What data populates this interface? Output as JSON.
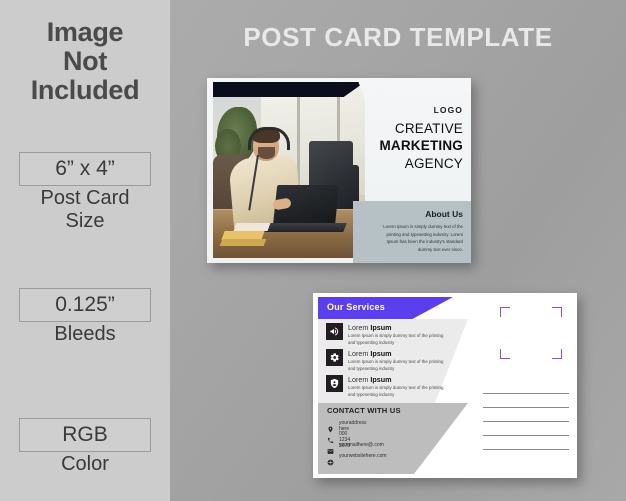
{
  "left_panel": {
    "headline_lines": [
      "Image",
      "Not",
      "Included"
    ],
    "specs": [
      {
        "value": "6” x 4”",
        "caption": "Post Card\nSize"
      },
      {
        "value": "0.125”",
        "caption": "Bleeds"
      },
      {
        "value": "RGB",
        "caption": "Color"
      }
    ]
  },
  "main_title": "POST CARD TEMPLATE",
  "front_card": {
    "logo": "LOGO",
    "company_line1": "CREATIVE",
    "company_line2": "MARKETING",
    "company_line3": "AGENCY",
    "about_title": "About Us",
    "about_body": "Lorem Ipsum is simply dummy text of the printing and typesetting industry. Lorem Ipsum has been the industry's standard dummy text ever since.",
    "accent_dark": "#0a0e1c",
    "about_panel_color": "#b6c1c5"
  },
  "back_card": {
    "services_title": "Our Services",
    "services": [
      {
        "icon": "megaphone-icon",
        "title_light": "Lorem ",
        "title_bold": "Ipsum",
        "body": "Lorem Ipsum is simply dummy text of the printing and typesetting industry"
      },
      {
        "icon": "gear-icon",
        "title_light": "Lorem ",
        "title_bold": "Ipsum",
        "body": "Lorem Ipsum is simply dummy text of the printing and typesetting industry"
      },
      {
        "icon": "shield-icon",
        "title_light": "Lorem ",
        "title_bold": "Ipsum",
        "body": "Lorem Ipsum is simply dummy text of the printing and typesetting industry"
      }
    ],
    "contact_title": "CONTACT WITH US",
    "contacts": [
      {
        "icon": "location-pin-icon",
        "text": "youraddress here"
      },
      {
        "icon": "phone-icon",
        "text": "000 1234 5678"
      },
      {
        "icon": "mail-icon",
        "text": "yourmailhere@.com"
      },
      {
        "icon": "globe-icon",
        "text": "yourwebsitehere.com"
      }
    ],
    "address_line_count": 5,
    "accent_purple": "#5b3fee",
    "stamp_corner_color": "#8d4ee0"
  },
  "colors": {
    "background": "#a5a5a5",
    "left_panel": "#cccccc",
    "title_text": "#e8e8e8"
  }
}
